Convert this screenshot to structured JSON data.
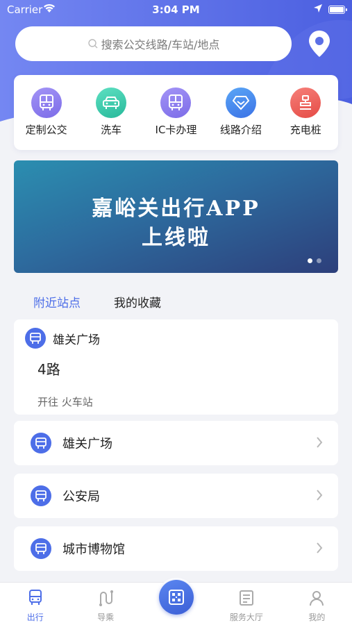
{
  "status_bar": {
    "carrier": "Carrier",
    "time": "3:04 PM"
  },
  "search": {
    "placeholder": "搜索公交线路/车站/地点"
  },
  "quick_actions": [
    {
      "label": "定制公交",
      "icon": "bus-icon",
      "color": "#8a7cf0"
    },
    {
      "label": "洗车",
      "icon": "car-icon",
      "color": "#3ecfb0"
    },
    {
      "label": "IC卡办理",
      "icon": "bus-card-icon",
      "color": "#8a7cf0"
    },
    {
      "label": "线路介绍",
      "icon": "diamond-icon",
      "color": "#4d8ef0"
    },
    {
      "label": "充电桩",
      "icon": "charger-icon",
      "color": "#f0605a"
    }
  ],
  "banner": {
    "line1": "嘉峪关出行APP",
    "line2": "上线啦"
  },
  "tabs": [
    {
      "label": "附近站点",
      "active": true
    },
    {
      "label": "我的收藏",
      "active": false
    }
  ],
  "featured_stop": {
    "name": "雄关广场",
    "route": "4路",
    "direction": "开往 火车站"
  },
  "stops": [
    {
      "name": "雄关广场"
    },
    {
      "name": "公安局"
    },
    {
      "name": "城市博物馆"
    }
  ],
  "tabbar": [
    {
      "label": "出行",
      "icon": "bus-icon",
      "active": true
    },
    {
      "label": "导乘",
      "icon": "route-icon",
      "active": false
    },
    {
      "label": "",
      "icon": "qr-code-icon",
      "active": false
    },
    {
      "label": "服务大厅",
      "icon": "news-icon",
      "active": false
    },
    {
      "label": "我的",
      "icon": "user-icon",
      "active": false
    }
  ],
  "colors": {
    "accent": "#4d6ee8",
    "header_start": "#6a7ff0",
    "header_end": "#4d62e0"
  }
}
